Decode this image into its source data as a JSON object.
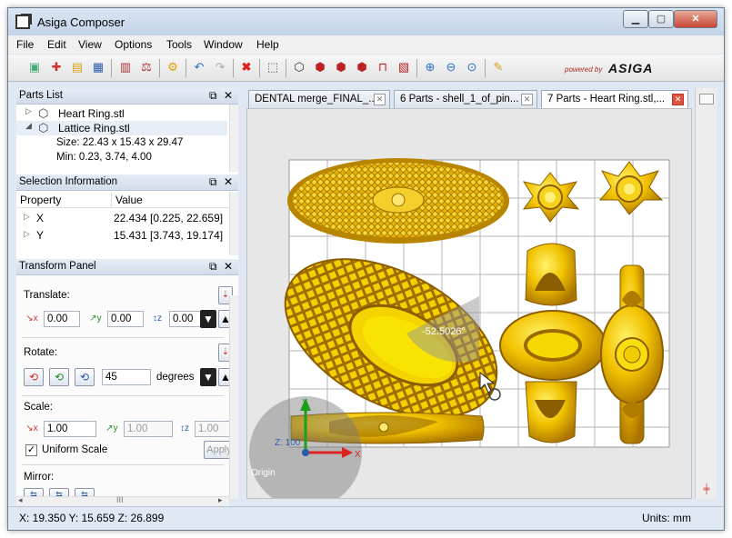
{
  "window": {
    "title": "Asiga Composer"
  },
  "menu": [
    "File",
    "Edit",
    "View",
    "Options",
    "Tools",
    "Window",
    "Help"
  ],
  "brand": {
    "small": "powered by",
    "big": "ASIGA"
  },
  "parts_list": {
    "header": "Parts List",
    "items": [
      {
        "label": "Heart Ring.stl",
        "expanded": false
      },
      {
        "label": "Lattice Ring.stl",
        "expanded": true
      }
    ],
    "details": [
      "Size: 22.43 x 15.43 x 29.47",
      "Min: 0.23, 3.74, 4.00"
    ]
  },
  "selection_info": {
    "header": "Selection Information",
    "columns": [
      "Property",
      "Value"
    ],
    "rows": [
      {
        "property": "X",
        "value": "22.434 [0.225, 22.659]"
      },
      {
        "property": "Y",
        "value": "15.431 [3.743, 19.174]"
      }
    ]
  },
  "transform_panel": {
    "header": "Transform Panel",
    "translate_label": "Translate:",
    "translate": {
      "x": "0.00",
      "y": "0.00",
      "z": "0.00"
    },
    "rotate_label": "Rotate:",
    "rotate_value": "45",
    "rotate_units": "degrees",
    "scale_label": "Scale:",
    "scale": {
      "x": "1.00",
      "y": "1.00",
      "z": "1.00"
    },
    "uniform_label": "Uniform Scale",
    "uniform_checked": true,
    "apply_label": "Apply",
    "mirror_label": "Mirror:"
  },
  "tabs": [
    {
      "label": "DENTAL merge_FINAL_...",
      "active": false
    },
    {
      "label": "6 Parts - shell_1_of_pin...",
      "active": false
    },
    {
      "label": "7 Parts - Heart Ring.stl,...",
      "active": true
    }
  ],
  "viewport": {
    "angle_label": "-52.5026°",
    "origin_label": "Origin",
    "axis_labels": {
      "x": "X",
      "y": "Y",
      "z": "Z: 100"
    }
  },
  "status": {
    "coords": "X: 19.350  Y: 15.659  Z: 26.899",
    "units": "Units: mm"
  },
  "colors": {
    "gold": "#f2c200",
    "gold_dark": "#b07c00",
    "accent_red": "#e2533c"
  }
}
